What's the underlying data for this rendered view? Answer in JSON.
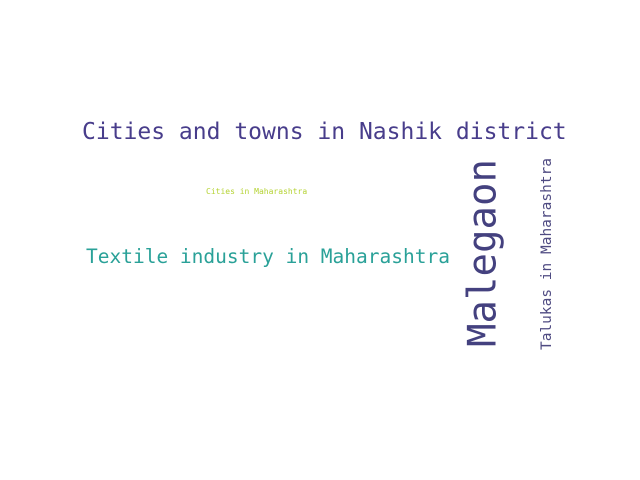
{
  "word_cloud": {
    "background": "#ffffff",
    "words": [
      {
        "text": "Cities and towns in Nashik district",
        "color": "#483d8b",
        "orientation": "horizontal"
      },
      {
        "text": "Textile industry in Maharashtra",
        "color": "#2aa198",
        "orientation": "horizontal"
      },
      {
        "text": "Cities in Maharashtra",
        "color": "#b5d334",
        "orientation": "horizontal"
      },
      {
        "text": "Malegaon",
        "color": "#44417f",
        "orientation": "vertical"
      },
      {
        "text": "Talukas in Maharashtra",
        "color": "#4f4b82",
        "orientation": "vertical"
      }
    ]
  }
}
